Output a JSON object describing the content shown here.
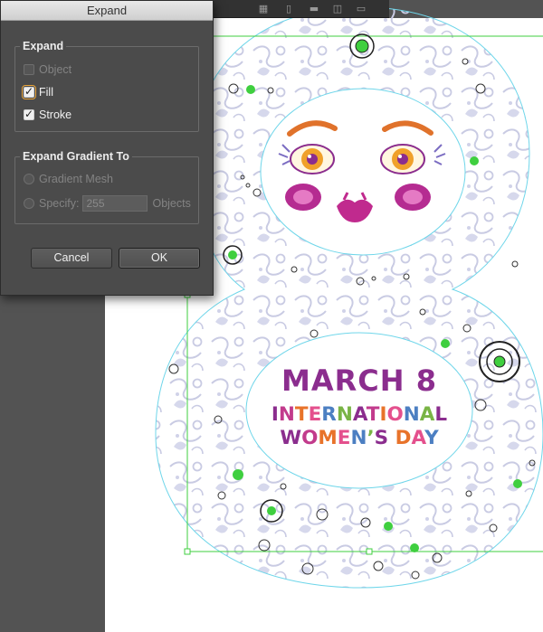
{
  "dialog": {
    "title": "Expand",
    "expand_group": {
      "title": "Expand",
      "options": [
        {
          "label": "Object",
          "checked": false,
          "enabled": false
        },
        {
          "label": "Fill",
          "checked": true,
          "enabled": true
        },
        {
          "label": "Stroke",
          "checked": true,
          "enabled": true
        }
      ]
    },
    "gradient_group": {
      "title": "Expand Gradient To",
      "gradient_mesh_label": "Gradient Mesh",
      "specify_label": "Specify:",
      "specify_value": "255",
      "objects_label": "Objects"
    },
    "cancel_label": "Cancel",
    "ok_label": "OK"
  },
  "artwork": {
    "line1": "MARCH 8",
    "line2": "INTERNATIONAL",
    "line3": "WOMEN’S DAY",
    "colors": {
      "pattern": "#c9cbe3",
      "guide": "#5fd3e8",
      "selection": "#3fcf3f",
      "purple": "#8b2d8e",
      "magenta": "#c23b8c",
      "orange": "#e8732a",
      "pink": "#e4508d",
      "blue": "#4c7fc2",
      "green": "#79b445"
    }
  },
  "toolbar": {
    "icons": [
      "grid-icon",
      "page-icon",
      "folder-icon",
      "layers-icon",
      "trash-icon"
    ]
  }
}
